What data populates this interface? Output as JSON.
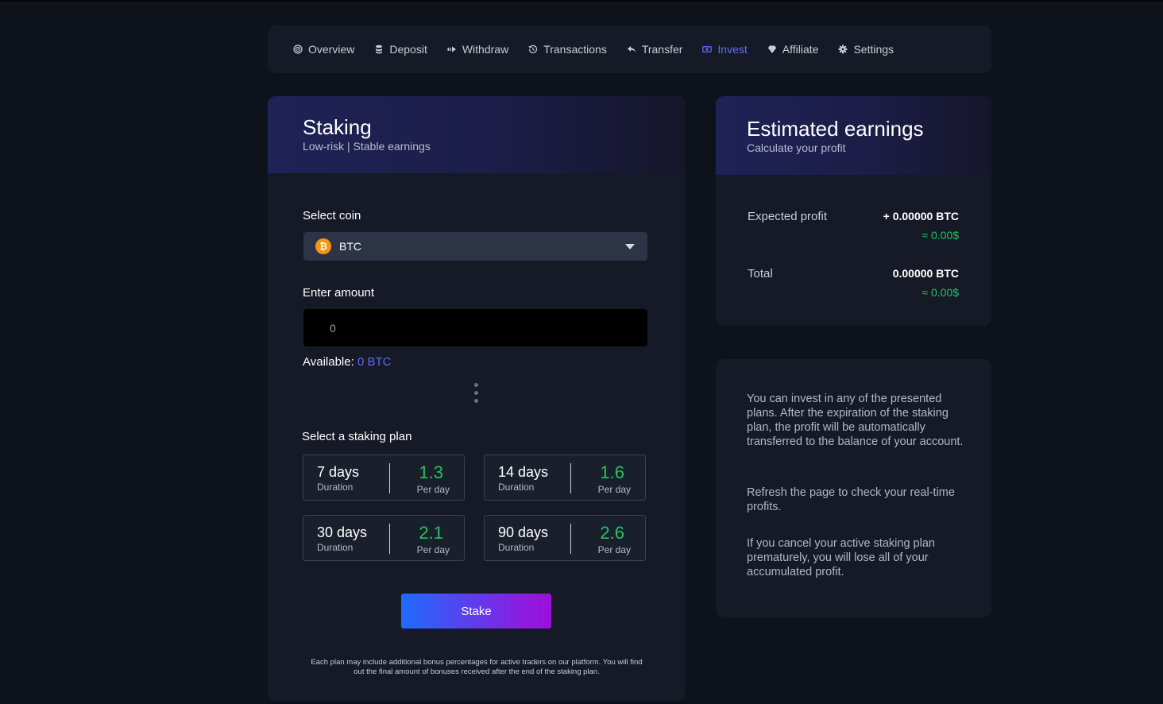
{
  "nav": {
    "items": [
      {
        "label": "Overview",
        "icon": "target-icon"
      },
      {
        "label": "Deposit",
        "icon": "database-icon"
      },
      {
        "label": "Withdraw",
        "icon": "arrow-right-icon"
      },
      {
        "label": "Transactions",
        "icon": "history-icon"
      },
      {
        "label": "Transfer",
        "icon": "reply-icon"
      },
      {
        "label": "Invest",
        "icon": "money-icon"
      },
      {
        "label": "Affiliate",
        "icon": "diamond-icon"
      },
      {
        "label": "Settings",
        "icon": "gear-icon"
      }
    ],
    "active": "Invest",
    "active_color": "#5b6cff"
  },
  "staking": {
    "title": "Staking",
    "subtitle": "Low-risk | Stable earnings",
    "select_coin_label": "Select coin",
    "selected_coin": "BTC",
    "coin_icon": "bitcoin-icon",
    "enter_amount_label": "Enter amount",
    "amount_value": "",
    "amount_placeholder": "0",
    "available_label": "Available:",
    "available_value": "0 BTC",
    "plan_label": "Select a staking plan",
    "plans": [
      {
        "days": "7 days",
        "duration_label": "Duration",
        "rate": "1.3",
        "per_day_label": "Per day"
      },
      {
        "days": "14 days",
        "duration_label": "Duration",
        "rate": "1.6",
        "per_day_label": "Per day"
      },
      {
        "days": "30 days",
        "duration_label": "Duration",
        "rate": "2.1",
        "per_day_label": "Per day"
      },
      {
        "days": "90 days",
        "duration_label": "Duration",
        "rate": "2.6",
        "per_day_label": "Per day"
      }
    ],
    "stake_label": "Stake",
    "footnote": "Each plan may include additional bonus percentages for active traders on our platform. You will find out the final amount of bonuses received after the end of the staking plan."
  },
  "earnings": {
    "title": "Estimated earnings",
    "subtitle": "Calculate your profit",
    "expected_label": "Expected profit",
    "expected_value": "+ 0.00000 BTC",
    "expected_usd": "≈ 0.00$",
    "total_label": "Total",
    "total_value": "0.00000 BTC",
    "total_usd": "≈ 0.00$"
  },
  "info": {
    "p1": "You can invest in any of the presented plans. After the expiration of the staking plan, the profit will be automatically transferred to the balance of your account.",
    "p2": "Refresh the page to check your real-time profits.",
    "p3": "If you cancel your active staking plan prematurely, you will lose all of your accumulated profit."
  },
  "colors": {
    "background": "#0e121b",
    "card": "#151a26",
    "accent_green": "#22c55e",
    "accent_blue": "#5b6cff",
    "btc_orange": "#f7931a"
  }
}
